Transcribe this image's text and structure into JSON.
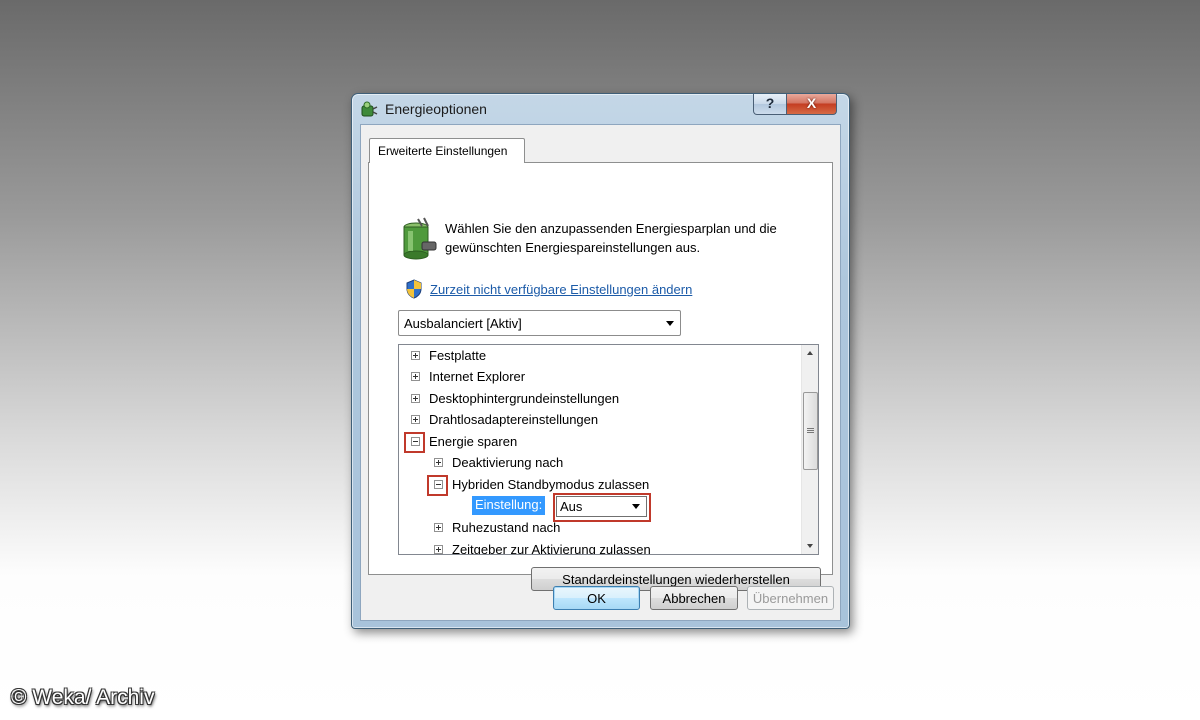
{
  "window": {
    "title": "Energieoptionen",
    "help_label": "?",
    "close_label": "X"
  },
  "tabs": [
    {
      "label": "Erweiterte Einstellungen",
      "active": true
    }
  ],
  "header": {
    "description": "Wählen Sie den anzupassenden Energiesparplan und die gewünschten Energiespareinstellungen aus.",
    "change_link": "Zurzeit nicht verfügbare Einstellungen ändern"
  },
  "plan_select": {
    "value": "Ausbalanciert [Aktiv]"
  },
  "tree": {
    "items": [
      {
        "label": "Festplatte",
        "state": "collapsed"
      },
      {
        "label": "Internet Explorer",
        "state": "collapsed"
      },
      {
        "label": "Desktophintergrundeinstellungen",
        "state": "collapsed"
      },
      {
        "label": "Drahtlosadaptereinstellungen",
        "state": "collapsed"
      },
      {
        "label": "Energie sparen",
        "state": "expanded"
      },
      {
        "label": "Deaktivierung nach",
        "state": "collapsed"
      },
      {
        "label": "Hybriden Standbymodus zulassen",
        "state": "expanded"
      },
      {
        "label": "Ruhezustand nach",
        "state": "collapsed"
      },
      {
        "label": "Zeitgeber zur Aktivierung zulassen",
        "state": "collapsed"
      }
    ],
    "setting_label": "Einstellung:",
    "setting_value": "Aus"
  },
  "buttons": {
    "restore": "Standardeinstellungen wiederherstellen",
    "ok": "OK",
    "cancel": "Abbrechen",
    "apply": "Übernehmen"
  },
  "copyright": "© Weka/ Archiv",
  "colors": {
    "link": "#1c5ba8",
    "highlight_box": "#c0392b",
    "selection": "#3399ff"
  }
}
